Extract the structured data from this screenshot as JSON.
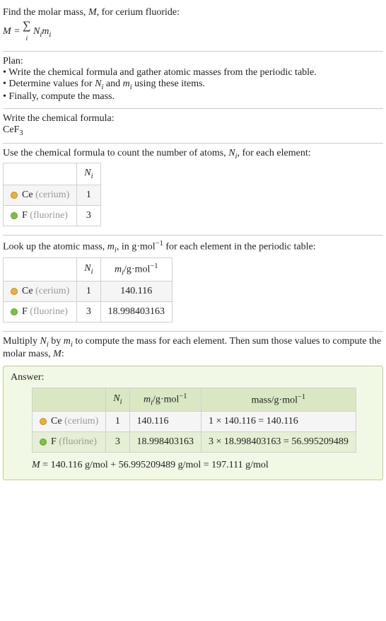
{
  "intro": {
    "line1_prefix": "Find the molar mass, ",
    "line1_var": "M",
    "line1_suffix": ", for cerium fluoride:",
    "formula_prefix": "M = ",
    "formula_sum": "∑",
    "formula_sub": "i",
    "formula_body_a": "N",
    "formula_body_b": "m"
  },
  "plan": {
    "title": "Plan:",
    "items": [
      "Write the chemical formula and gather atomic masses from the periodic table.",
      "Determine values for Nᵢ and mᵢ using these items.",
      "Finally, compute the mass."
    ],
    "item1_prefix": "Determine values for ",
    "item1_var1": "N",
    "item1_sub1": "i",
    "item1_mid": " and ",
    "item1_var2": "m",
    "item1_sub2": "i",
    "item1_suffix": " using these items."
  },
  "write": {
    "title": "Write the chemical formula:",
    "formula_base": "CeF",
    "formula_sub": "3"
  },
  "count": {
    "title_prefix": "Use the chemical formula to count the number of atoms, ",
    "title_var": "N",
    "title_sub": "i",
    "title_suffix": ", for each element:",
    "header_N": "N",
    "header_N_sub": "i",
    "rows": [
      {
        "color": "#f0b030",
        "name": "Ce",
        "label": "(cerium)",
        "n": "1"
      },
      {
        "color": "#7fc040",
        "name": "F",
        "label": "(fluorine)",
        "n": "3"
      }
    ]
  },
  "lookup": {
    "title_prefix": "Look up the atomic mass, ",
    "title_var": "m",
    "title_sub": "i",
    "title_mid": ", in g·mol",
    "title_sup": "−1",
    "title_suffix": " for each element in the periodic table:",
    "header_m": "m",
    "header_m_sub": "i",
    "header_unit_prefix": "/g·mol",
    "header_unit_sup": "−1",
    "rows": [
      {
        "color": "#f0b030",
        "name": "Ce",
        "label": "(cerium)",
        "n": "1",
        "m": "140.116"
      },
      {
        "color": "#7fc040",
        "name": "F",
        "label": "(fluorine)",
        "n": "3",
        "m": "18.998403163"
      }
    ]
  },
  "multiply": {
    "text_prefix": "Multiply ",
    "var_N": "N",
    "sub_i": "i",
    "text_by": " by ",
    "var_m": "m",
    "text_suffix": " to compute the mass for each element. Then sum those values to compute the molar mass, ",
    "var_M": "M",
    "text_end": ":"
  },
  "answer": {
    "title": "Answer:",
    "headers": {
      "N": "N",
      "N_sub": "i",
      "m": "m",
      "m_sub": "i",
      "m_unit_prefix": "/g·mol",
      "m_unit_sup": "−1",
      "mass_prefix": "mass/g·mol",
      "mass_sup": "−1"
    },
    "rows": [
      {
        "color": "#f0b030",
        "name": "Ce",
        "label": "(cerium)",
        "n": "1",
        "m": "140.116",
        "mass": "1 × 140.116 = 140.116"
      },
      {
        "color": "#7fc040",
        "name": "F",
        "label": "(fluorine)",
        "n": "3",
        "m": "18.998403163",
        "mass": "3 × 18.998403163 = 56.995209489"
      }
    ],
    "result_prefix": "M",
    "result_text": " = 140.116 g/mol + 56.995209489 g/mol = 197.111 g/mol"
  }
}
